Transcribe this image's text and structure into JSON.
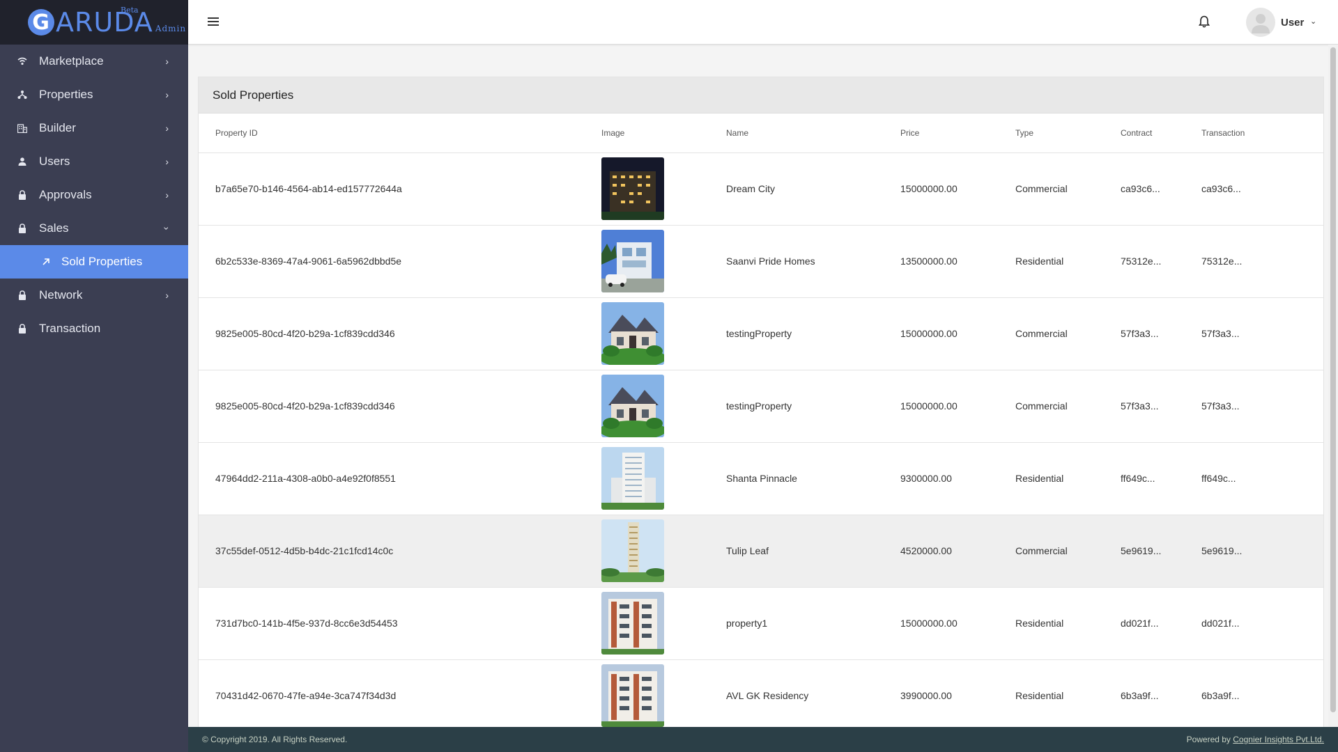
{
  "brand": {
    "initial": "G",
    "name": "ARUDA",
    "beta": "Beta",
    "admin": "Admin"
  },
  "sidebar": {
    "items": [
      {
        "label": "Marketplace",
        "icon": "wifi-icon",
        "has_chevron": true
      },
      {
        "label": "Properties",
        "icon": "hierarchy-icon",
        "has_chevron": true
      },
      {
        "label": "Builder",
        "icon": "building-icon",
        "has_chevron": true
      },
      {
        "label": "Users",
        "icon": "person-icon",
        "has_chevron": true
      },
      {
        "label": "Approvals",
        "icon": "lock-icon",
        "has_chevron": true
      },
      {
        "label": "Sales",
        "icon": "lock-icon",
        "has_chevron": true,
        "expanded": true
      },
      {
        "label": "Sold Properties",
        "icon": "arrow-up-right-icon",
        "active": true
      },
      {
        "label": "Network",
        "icon": "lock-icon",
        "has_chevron": true
      },
      {
        "label": "Transaction",
        "icon": "lock-icon"
      }
    ]
  },
  "topbar": {
    "user_name": "User"
  },
  "card": {
    "title": "Sold Properties"
  },
  "table": {
    "headers": [
      "Property ID",
      "Image",
      "Name",
      "Price",
      "Type",
      "Contract",
      "Transaction"
    ],
    "rows": [
      {
        "id": "b7a65e70-b146-4564-ab14-ed157772644a",
        "name": "Dream City",
        "price": "15000000.00",
        "type": "Commercial",
        "contract": "ca93c6...",
        "transaction": "ca93c6...",
        "image": "night-apartments"
      },
      {
        "id": "6b2c533e-8369-47a4-9061-6a5962dbbd5e",
        "name": "Saanvi Pride Homes",
        "price": "13500000.00",
        "type": "Residential",
        "contract": "75312e...",
        "transaction": "75312e...",
        "image": "villa-car"
      },
      {
        "id": "9825e005-80cd-4f20-b29a-1cf839cdd346",
        "name": "testingProperty",
        "price": "15000000.00",
        "type": "Commercial",
        "contract": "57f3a3...",
        "transaction": "57f3a3...",
        "image": "cottage"
      },
      {
        "id": "9825e005-80cd-4f20-b29a-1cf839cdd346",
        "name": "testingProperty",
        "price": "15000000.00",
        "type": "Commercial",
        "contract": "57f3a3...",
        "transaction": "57f3a3...",
        "image": "cottage"
      },
      {
        "id": "47964dd2-211a-4308-a0b0-a4e92f0f8551",
        "name": "Shanta Pinnacle",
        "price": "9300000.00",
        "type": "Residential",
        "contract": "ff649c...",
        "transaction": "ff649c...",
        "image": "white-tower"
      },
      {
        "id": "37c55def-0512-4d5b-b4dc-21c1fcd14c0c",
        "name": "Tulip Leaf",
        "price": "4520000.00",
        "type": "Commercial",
        "contract": "5e9619...",
        "transaction": "5e9619...",
        "image": "tall-tower",
        "highlighted": true
      },
      {
        "id": "731d7bc0-141b-4f5e-937d-8cc6e3d54453",
        "name": "property1",
        "price": "15000000.00",
        "type": "Residential",
        "contract": "dd021f...",
        "transaction": "dd021f...",
        "image": "apartment-block"
      },
      {
        "id": "70431d42-0670-47fe-a94e-3ca747f34d3d",
        "name": "AVL GK Residency",
        "price": "3990000.00",
        "type": "Residential",
        "contract": "6b3a9f...",
        "transaction": "6b3a9f...",
        "image": "apartment-block"
      }
    ]
  },
  "footer": {
    "copyright": "© Copyright 2019. All Rights Reserved.",
    "powered_prefix": "Powered by ",
    "powered_link": "Cognier Insights Pvt.Ltd."
  },
  "colors": {
    "sidebar_bg": "#3b3e52",
    "brand_bg": "#20222c",
    "accent": "#5b8ae8",
    "footer_bg": "#2b3f47"
  }
}
